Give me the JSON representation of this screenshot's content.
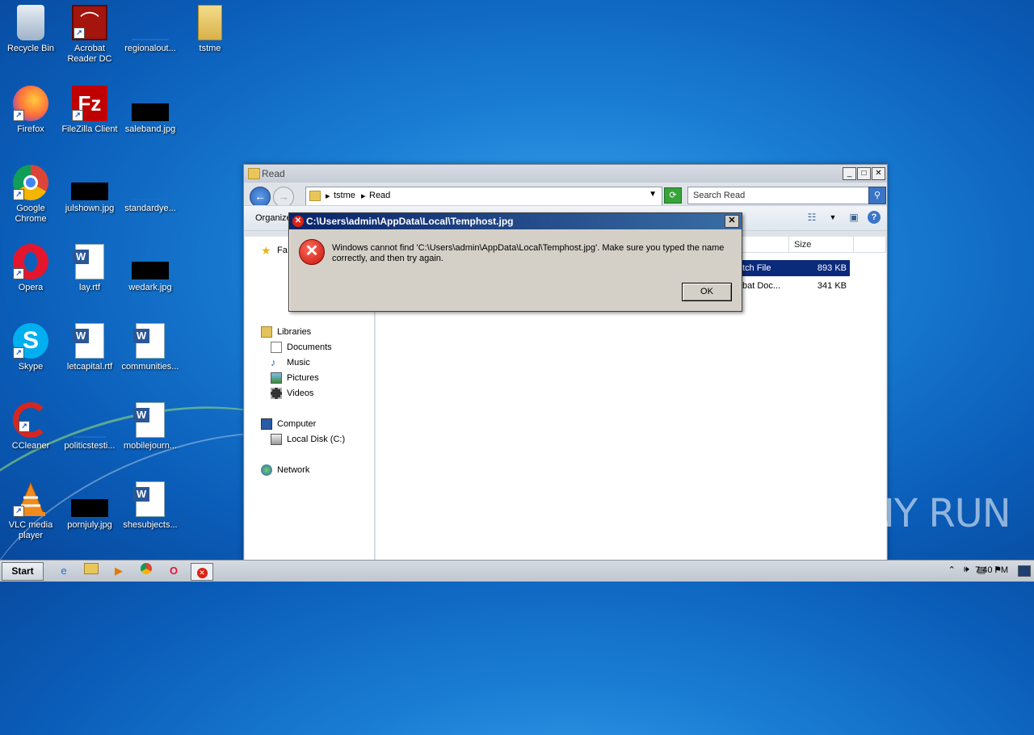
{
  "desktop": {
    "icons": [
      {
        "label": "Recycle Bin"
      },
      {
        "label": "Acrobat Reader DC"
      },
      {
        "label": "regionalout..."
      },
      {
        "label": "tstme"
      },
      {
        "label": "Firefox"
      },
      {
        "label": "FileZilla Client"
      },
      {
        "label": "saleband.jpg"
      },
      {
        "label": "Google Chrome"
      },
      {
        "label": "julshown.jpg"
      },
      {
        "label": "standardye..."
      },
      {
        "label": "Opera"
      },
      {
        "label": "lay.rtf"
      },
      {
        "label": "wedark.jpg"
      },
      {
        "label": "Skype"
      },
      {
        "label": "letcapital.rtf"
      },
      {
        "label": "communities..."
      },
      {
        "label": "CCleaner"
      },
      {
        "label": "politicstesti..."
      },
      {
        "label": "mobilejourn..."
      },
      {
        "label": "VLC media player"
      },
      {
        "label": "pornjuly.jpg"
      },
      {
        "label": "shesubjects..."
      }
    ]
  },
  "explorer": {
    "title": "Read",
    "breadcrumb": [
      "tstme",
      "Read"
    ],
    "search_placeholder": "Search Read",
    "organize_label": "Organize",
    "nav": {
      "favorites": "Fa",
      "libraries": "Libraries",
      "documents": "Documents",
      "music": "Music",
      "pictures": "Pictures",
      "videos": "Videos",
      "computer": "Computer",
      "local_disk": "Local Disk (C:)",
      "network": "Network"
    },
    "columns": {
      "size": "Size"
    },
    "rows": [
      {
        "type": "tch File",
        "size": "893 KB"
      },
      {
        "type": "bat Doc...",
        "size": "341 KB"
      }
    ]
  },
  "dialog": {
    "title": "C:\\Users\\admin\\AppData\\Local\\Temphost.jpg",
    "message": "Windows cannot find 'C:\\Users\\admin\\AppData\\Local\\Temphost.jpg'. Make sure you typed the name correctly, and then try again.",
    "ok_label": "OK"
  },
  "taskbar": {
    "start_label": "Start",
    "clock": "7:40 PM"
  },
  "watermark": "ANY RUN"
}
